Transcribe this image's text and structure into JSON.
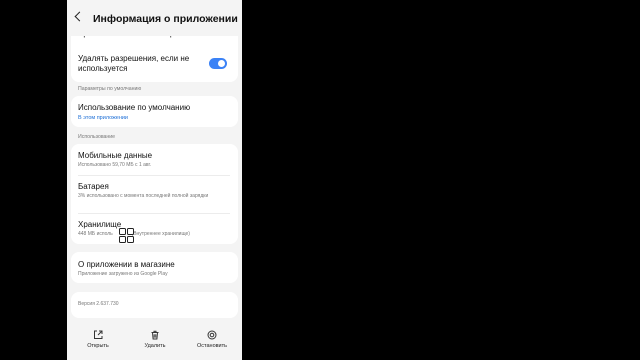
{
  "header": {
    "title": "Информация о приложении"
  },
  "permissions": {
    "partial_item": "Время использования экрана",
    "remove_perms_label": "Удалять разрешения, если не используется",
    "toggle_on": true
  },
  "defaults": {
    "section": "Параметры по умолчанию",
    "default_usage_title": "Использование по умолчанию",
    "default_usage_link": "В этом приложении"
  },
  "usage": {
    "section": "Использование",
    "mobile_title": "Мобильные данные",
    "mobile_sub": "Использовано 59,70 МБ с 1 авг.",
    "battery_title": "Батарея",
    "battery_sub": "3% использовано с момента последней полной зарядки",
    "storage_title": "Хранилище",
    "storage_sub_left": "448 МБ исполь",
    "storage_sub_right": "(Внутреннее хранилище)"
  },
  "store": {
    "title": "О приложении в магазине",
    "sub": "Приложение загружено из Google Play"
  },
  "version": "Версия 2.637.730",
  "bottom_bar": {
    "open": "Открыть",
    "delete": "Удалить",
    "stop": "Остановить"
  },
  "colors": {
    "accent": "#3b82f6",
    "link": "#1e6fd6",
    "background": "#f4f4f4"
  },
  "icons": {
    "back": "back-arrow-icon",
    "open": "open-external-icon",
    "delete": "trash-icon",
    "stop": "stop-icon",
    "overlay": "apps-grid-icon"
  }
}
